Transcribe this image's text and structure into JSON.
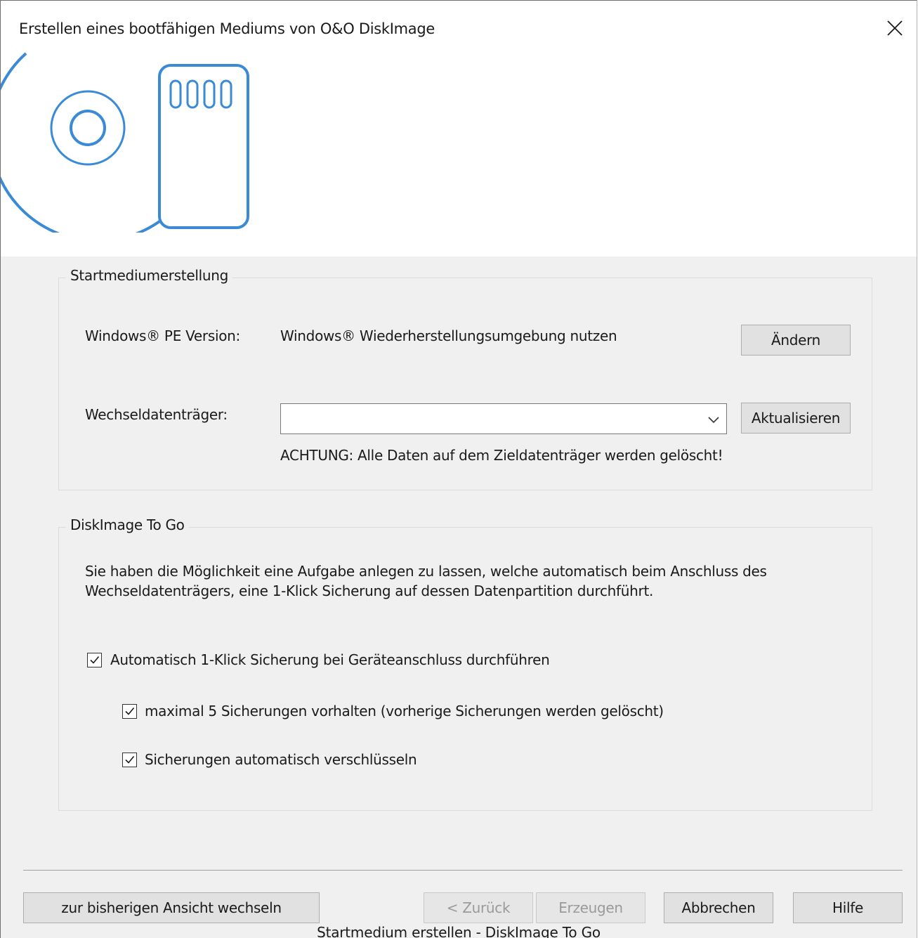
{
  "window": {
    "title": "Erstellen eines bootfähigen Mediums von O&O DiskImage",
    "close_icon": "close-icon"
  },
  "startmedium": {
    "legend": "Startmediumerstellung",
    "pe_label": "Windows® PE Version:",
    "pe_value": "Windows® Wiederherstellungsumgebung nutzen",
    "change_button": "Ändern",
    "drive_label": "Wechseldatenträger:",
    "drive_value": "",
    "refresh_button": "Aktualisieren",
    "warning": "ACHTUNG: Alle Daten auf dem Zieldatenträger werden gelöscht!"
  },
  "togo": {
    "legend": "DiskImage To Go",
    "description_line1": "Sie haben die Möglichkeit eine Aufgabe anlegen zu lassen, welche automatisch beim Anschluss des",
    "description_line2": "Wechseldatenträgers, eine 1-Klick Sicherung auf dessen Datenpartition durchführt.",
    "options": [
      {
        "label": "Automatisch 1-Klick Sicherung bei Geräteanschluss durchführen",
        "checked": true
      },
      {
        "label": "maximal 5 Sicherungen vorhalten (vorherige Sicherungen werden gelöscht)",
        "checked": true
      },
      {
        "label": "Sicherungen automatisch verschlüsseln",
        "checked": true
      }
    ]
  },
  "footer": {
    "switch_view_button": "zur bisherigen Ansicht wechseln",
    "back_button": "< Zurück",
    "create_button": "Erzeugen",
    "cancel_button": "Abbrechen",
    "help_button": "Hilfe"
  },
  "caption": "Startmedium erstellen - DiskImage To Go",
  "colors": {
    "accent": "#3a8ad6",
    "panel_bg": "#f0f0f0",
    "button_bg": "#e1e1e1"
  }
}
